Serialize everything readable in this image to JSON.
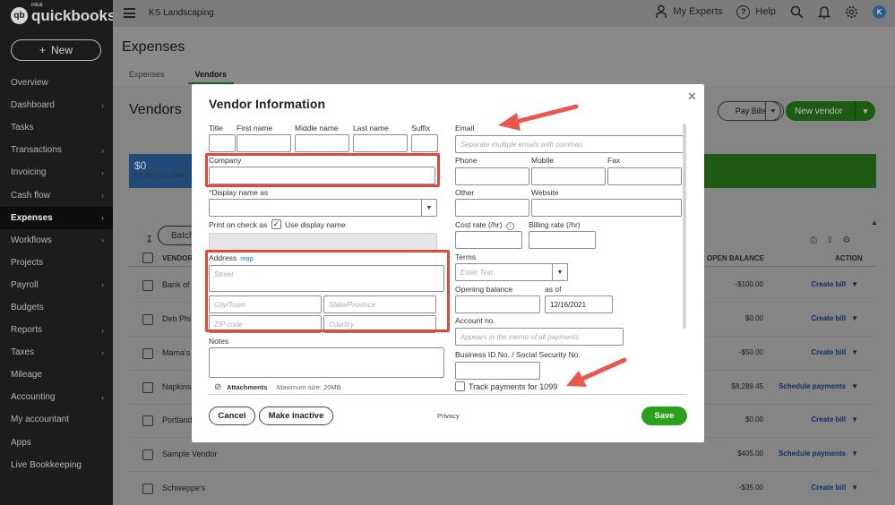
{
  "brand": {
    "badge": "qb",
    "name": "quickbooks",
    "intuit": "intuit"
  },
  "sidebar": {
    "new_label": "New",
    "new_icon": "plus-icon",
    "items": [
      {
        "label": "Overview",
        "chevron": false
      },
      {
        "label": "Dashboard",
        "chevron": true
      },
      {
        "label": "Tasks",
        "chevron": false
      },
      {
        "label": "Transactions",
        "chevron": true
      },
      {
        "label": "Invoicing",
        "chevron": true
      },
      {
        "label": "Cash flow",
        "chevron": true
      },
      {
        "label": "Expenses",
        "chevron": true,
        "active": true
      },
      {
        "label": "Workflows",
        "chevron": true
      },
      {
        "label": "Projects",
        "chevron": false
      },
      {
        "label": "Payroll",
        "chevron": true
      },
      {
        "label": "Budgets",
        "chevron": false
      },
      {
        "label": "Reports",
        "chevron": true
      },
      {
        "label": "Taxes",
        "chevron": true
      },
      {
        "label": "Mileage",
        "chevron": false
      },
      {
        "label": "Accounting",
        "chevron": true
      },
      {
        "label": "My accountant",
        "chevron": false
      },
      {
        "label": "Apps",
        "chevron": false
      },
      {
        "label": "Live Bookkeeping",
        "chevron": false
      }
    ]
  },
  "topbar": {
    "company": "KS Landscaping",
    "experts": "My Experts",
    "help": "Help",
    "avatar": "K"
  },
  "page": {
    "title": "Expenses",
    "tabs": [
      "Expenses",
      "Vendors"
    ],
    "active_tab": "Vendors",
    "vendors_title": "Vendors",
    "pay_bills": "Pay Bills",
    "new_vendor": "New vendor",
    "money_amount": "$0",
    "money_label": "0 PURCHASE ORDE",
    "batch": "Batch",
    "col_vendor": "VENDOR",
    "col_balance": "OPEN BALANCE",
    "col_action": "ACTION"
  },
  "rows": [
    {
      "name": "Bank of",
      "balance": "-$100.00",
      "action": "Create bill"
    },
    {
      "name": "Deb Phi",
      "balance": "$0.00",
      "action": "Create bill"
    },
    {
      "name": "Mama's",
      "balance": "-$50.00",
      "action": "Create bill"
    },
    {
      "name": "Napkins",
      "balance": "$8,289.45",
      "action": "Schedule payments"
    },
    {
      "name": "Portland",
      "balance": "$0.00",
      "action": "Create bill"
    },
    {
      "name": "Sample Vendor",
      "balance": "$405.00",
      "action": "Schedule payments"
    },
    {
      "name": "Schweppe's",
      "balance": "-$35.00",
      "action": "Create bill"
    }
  ],
  "modal": {
    "title": "Vendor Information",
    "title_label": "Title",
    "first_name": "First name",
    "middle_name": "Middle name",
    "last_name": "Last name",
    "suffix": "Suffix",
    "company": "Company",
    "display_name_required": "*",
    "display_name": "Display name as",
    "print_check": "Print on check as",
    "use_display": "Use display name",
    "address": "Address",
    "map": "map",
    "street_ph": "Street",
    "city_ph": "City/Town",
    "state_ph": "State/Province",
    "zip_ph": "ZIP code",
    "country_ph": "Country",
    "notes": "Notes",
    "attachments": "Attachments",
    "max_size": "Maximum size: 20MB",
    "email": "Email",
    "email_ph": "Separate multiple emails with commas",
    "phone": "Phone",
    "mobile": "Mobile",
    "fax": "Fax",
    "other": "Other",
    "website": "Website",
    "cost_rate": "Cost rate (/hr)",
    "billing_rate": "Billing rate (/hr)",
    "terms": "Terms",
    "terms_ph": "Enter Text",
    "opening_balance": "Opening balance",
    "as_of": "as of",
    "as_of_value": "12/16/2021",
    "account_no": "Account no.",
    "account_ph": "Appears in the memo of all payments",
    "business_id": "Business ID No. / Social Security No.",
    "track_1099": "Track payments for 1099",
    "cancel": "Cancel",
    "make_inactive": "Make inactive",
    "privacy": "Privacy",
    "save": "Save"
  },
  "colors": {
    "highlight": "#e0473f",
    "save_green": "#2ca01c",
    "arrow": "#e8584f",
    "sidebar_bg": "#1c1c1c",
    "link_blue": "#0077c5"
  }
}
